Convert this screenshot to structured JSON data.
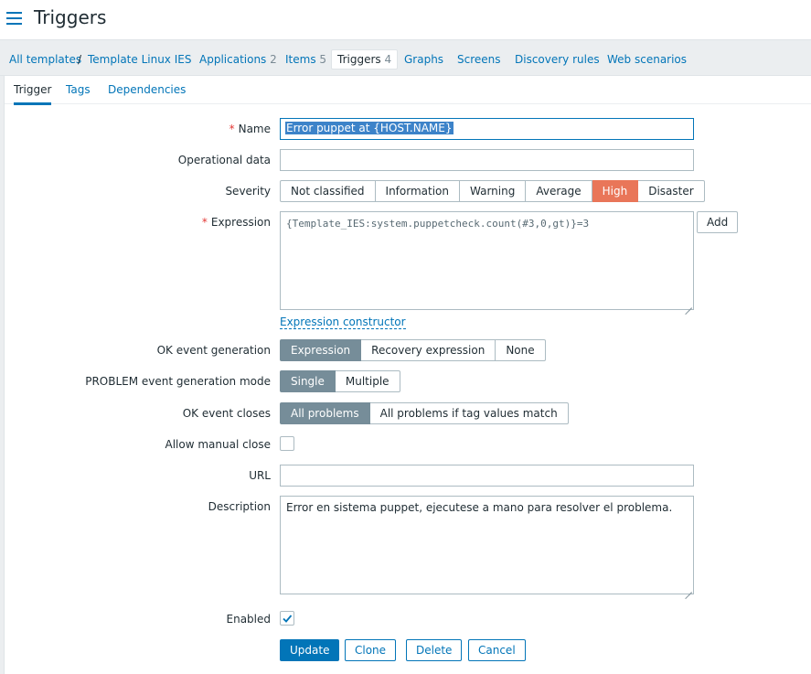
{
  "header": {
    "title": "Triggers",
    "menu_icon": "hamburger-menu-icon"
  },
  "breadcrumb": {
    "all_templates": "All templates",
    "separator": "/",
    "template": "Template Linux IES",
    "tabs": [
      {
        "label": "Applications",
        "count": "2"
      },
      {
        "label": "Items",
        "count": "5"
      },
      {
        "label": "Triggers",
        "count": "4"
      },
      {
        "label": "Graphs",
        "count": ""
      },
      {
        "label": "Screens",
        "count": ""
      },
      {
        "label": "Discovery rules",
        "count": ""
      },
      {
        "label": "Web scenarios",
        "count": ""
      }
    ]
  },
  "subtabs": [
    "Trigger",
    "Tags",
    "Dependencies"
  ],
  "form": {
    "name": {
      "label": "Name",
      "value": "Error puppet at  {HOST.NAME}"
    },
    "operational_data": {
      "label": "Operational data",
      "value": ""
    },
    "severity": {
      "label": "Severity",
      "options": [
        "Not classified",
        "Information",
        "Warning",
        "Average",
        "High",
        "Disaster"
      ],
      "selected": "High"
    },
    "expression": {
      "label": "Expression",
      "value": "{Template_IES:system.puppetcheck.count(#3,0,gt)}=3",
      "add_label": "Add",
      "constructor_link": "Expression constructor"
    },
    "ok_event_generation": {
      "label": "OK event generation",
      "options": [
        "Expression",
        "Recovery expression",
        "None"
      ],
      "selected": "Expression"
    },
    "problem_mode": {
      "label": "PROBLEM event generation mode",
      "options": [
        "Single",
        "Multiple"
      ],
      "selected": "Single"
    },
    "ok_event_closes": {
      "label": "OK event closes",
      "options": [
        "All problems",
        "All problems if tag values match"
      ],
      "selected": "All problems"
    },
    "allow_manual_close": {
      "label": "Allow manual close",
      "checked": false
    },
    "url": {
      "label": "URL",
      "value": ""
    },
    "description": {
      "label": "Description",
      "value": "Error en sistema puppet, ejecutese a mano para resolver el problema."
    },
    "enabled": {
      "label": "Enabled",
      "checked": true
    }
  },
  "buttons": {
    "update": "Update",
    "clone": "Clone",
    "delete": "Delete",
    "cancel": "Cancel"
  },
  "colors": {
    "accent": "#0275b8",
    "severity_high": "#e97659",
    "segment_selected": "#768d99"
  }
}
